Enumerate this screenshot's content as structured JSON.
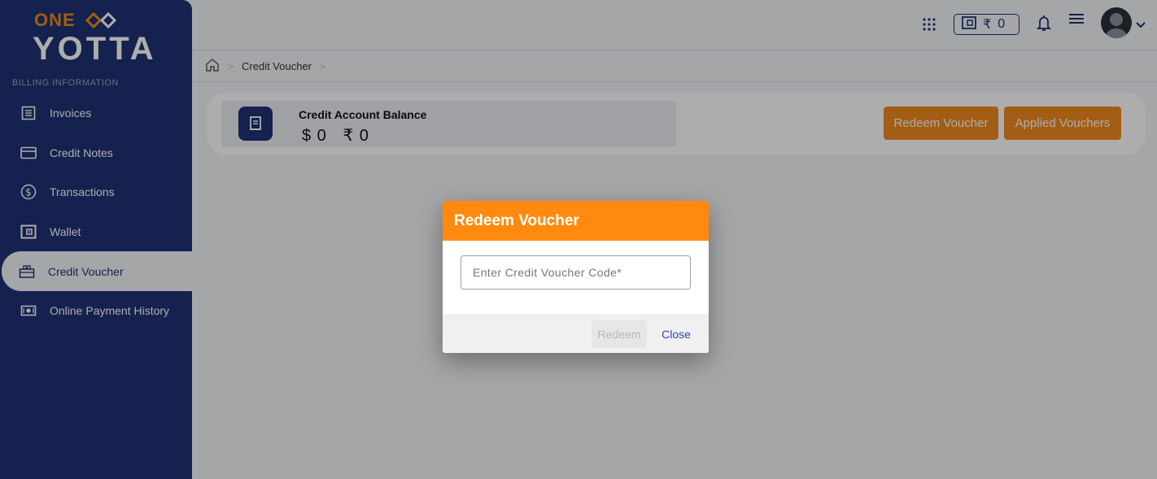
{
  "brand": {
    "line1": "ONE",
    "line2": "YOTTA",
    "accent": "#f08a1e",
    "navy": "#1f3274"
  },
  "sidebar": {
    "section_label": "BILLING INFORMATION",
    "items": [
      {
        "label": "Invoices",
        "icon": "invoice-icon"
      },
      {
        "label": "Credit Notes",
        "icon": "card-icon"
      },
      {
        "label": "Transactions",
        "icon": "dollar-circle-icon"
      },
      {
        "label": "Wallet",
        "icon": "wallet-icon"
      },
      {
        "label": "Credit Voucher",
        "icon": "voucher-icon",
        "active": true
      },
      {
        "label": "Online Payment History",
        "icon": "cash-icon"
      }
    ]
  },
  "topbar": {
    "wallet_currency": "₹",
    "wallet_amount": "0"
  },
  "breadcrumb": {
    "current": "Credit Voucher"
  },
  "balance": {
    "title": "Credit Account Balance",
    "usd": "$ 0",
    "inr": "₹ 0"
  },
  "actions": {
    "redeem_voucher": "Redeem Voucher",
    "applied_vouchers": "Applied Vouchers"
  },
  "modal": {
    "title": "Redeem Voucher",
    "input_placeholder": "Enter Credit Voucher Code*",
    "redeem_label": "Redeem",
    "close_label": "Close"
  }
}
